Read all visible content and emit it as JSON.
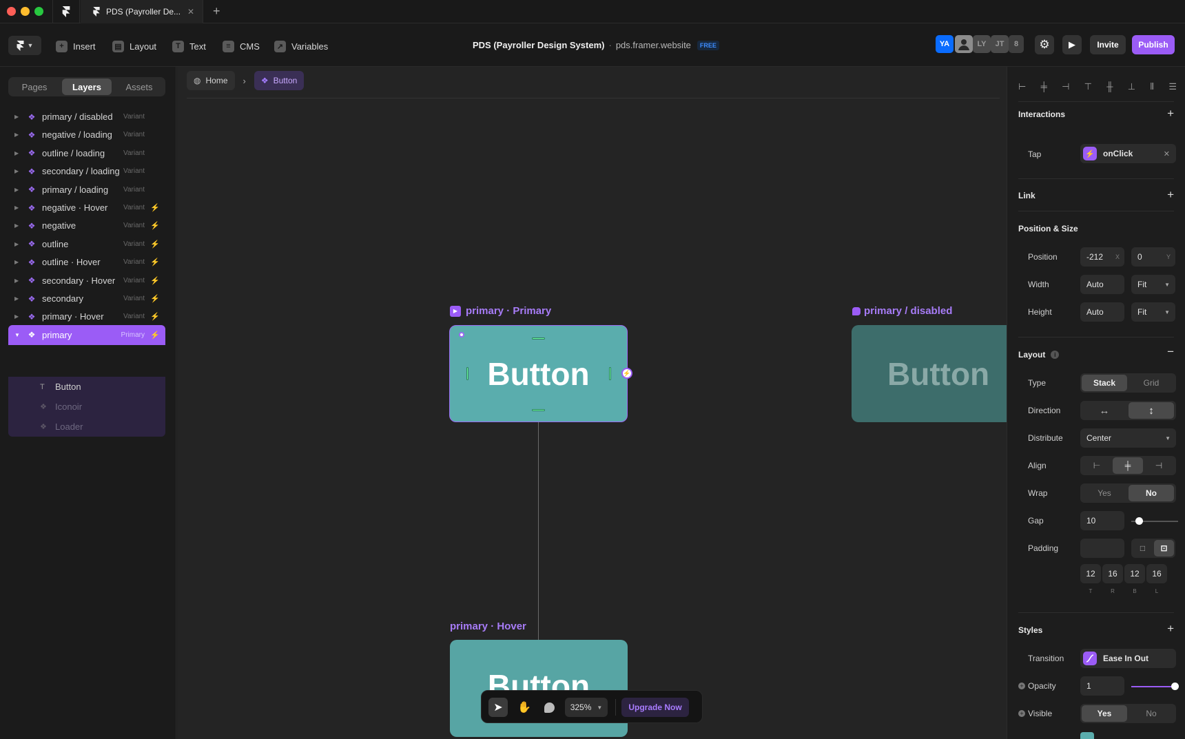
{
  "window": {
    "tab_title": "PDS (Payroller De...",
    "new_tab_icon": "plus-icon"
  },
  "toolbar": {
    "insert": "Insert",
    "layout": "Layout",
    "text": "Text",
    "cms": "CMS",
    "variables": "Variables",
    "project_title": "PDS (Payroller Design System)",
    "separator": "·",
    "domain": "pds.framer.website",
    "plan_badge": "FREE",
    "avatars": [
      "YA",
      "LY",
      "JT",
      "8"
    ],
    "invite": "Invite",
    "publish": "Publish",
    "accent": "#9b5cf6"
  },
  "left_panel": {
    "tabs": [
      "Pages",
      "Layers",
      "Assets"
    ],
    "active_tab": "Layers",
    "layers": [
      {
        "name": "primary / disabled",
        "type": "Variant",
        "bolt": false
      },
      {
        "name": "negative / loading",
        "type": "Variant",
        "bolt": false
      },
      {
        "name": "outline / loading",
        "type": "Variant",
        "bolt": false
      },
      {
        "name": "secondary / loading",
        "type": "Variant",
        "bolt": false
      },
      {
        "name": "primary / loading",
        "type": "Variant",
        "bolt": false
      },
      {
        "name": "negative · Hover",
        "type": "Variant",
        "bolt": true
      },
      {
        "name": "negative",
        "type": "Variant",
        "bolt": true
      },
      {
        "name": "outline",
        "type": "Variant",
        "bolt": true
      },
      {
        "name": "outline · Hover",
        "type": "Variant",
        "bolt": true
      },
      {
        "name": "secondary · Hover",
        "type": "Variant",
        "bolt": true
      },
      {
        "name": "secondary",
        "type": "Variant",
        "bolt": true
      },
      {
        "name": "primary · Hover",
        "type": "Variant",
        "bolt": true
      },
      {
        "name": "primary",
        "type": "Primary",
        "bolt": true
      }
    ],
    "children": [
      "Button",
      "Iconoir",
      "Loader"
    ]
  },
  "canvas": {
    "breadcrumb_home": "Home",
    "breadcrumb_current": "Button",
    "frame1_label": "primary · Primary",
    "frame1_text": "Button",
    "frame2_label": "primary / disabled",
    "frame2_text": "Button",
    "frame3_label": "primary · Hover",
    "frame3_text": "Button",
    "zoom": "325%",
    "upgrade": "Upgrade Now"
  },
  "right_panel": {
    "interactions": {
      "title": "Interactions",
      "tap_label": "Tap",
      "tap_value": "onClick"
    },
    "link": {
      "title": "Link"
    },
    "position_size": {
      "title": "Position & Size",
      "position_label": "Position",
      "x": "-212",
      "x_unit": "X",
      "y": "0",
      "y_unit": "Y",
      "width_label": "Width",
      "width_value": "Auto",
      "width_mode": "Fit",
      "height_label": "Height",
      "height_value": "Auto",
      "height_mode": "Fit"
    },
    "layout": {
      "title": "Layout",
      "type_label": "Type",
      "type_options": [
        "Stack",
        "Grid"
      ],
      "type_active": "Stack",
      "direction_label": "Direction",
      "distribute_label": "Distribute",
      "distribute_value": "Center",
      "align_label": "Align",
      "wrap_label": "Wrap",
      "wrap_options": [
        "Yes",
        "No"
      ],
      "wrap_active": "No",
      "gap_label": "Gap",
      "gap_value": "10",
      "padding_label": "Padding",
      "padding_values": [
        "12",
        "16",
        "12",
        "16"
      ],
      "padding_sides": [
        "T",
        "R",
        "B",
        "L"
      ]
    },
    "styles": {
      "title": "Styles",
      "transition_label": "Transition",
      "transition_value": "Ease In Out",
      "opacity_label": "Opacity",
      "opacity_value": "1",
      "visible_label": "Visible",
      "visible_options": [
        "Yes",
        "No"
      ],
      "visible_active": "Yes"
    }
  }
}
